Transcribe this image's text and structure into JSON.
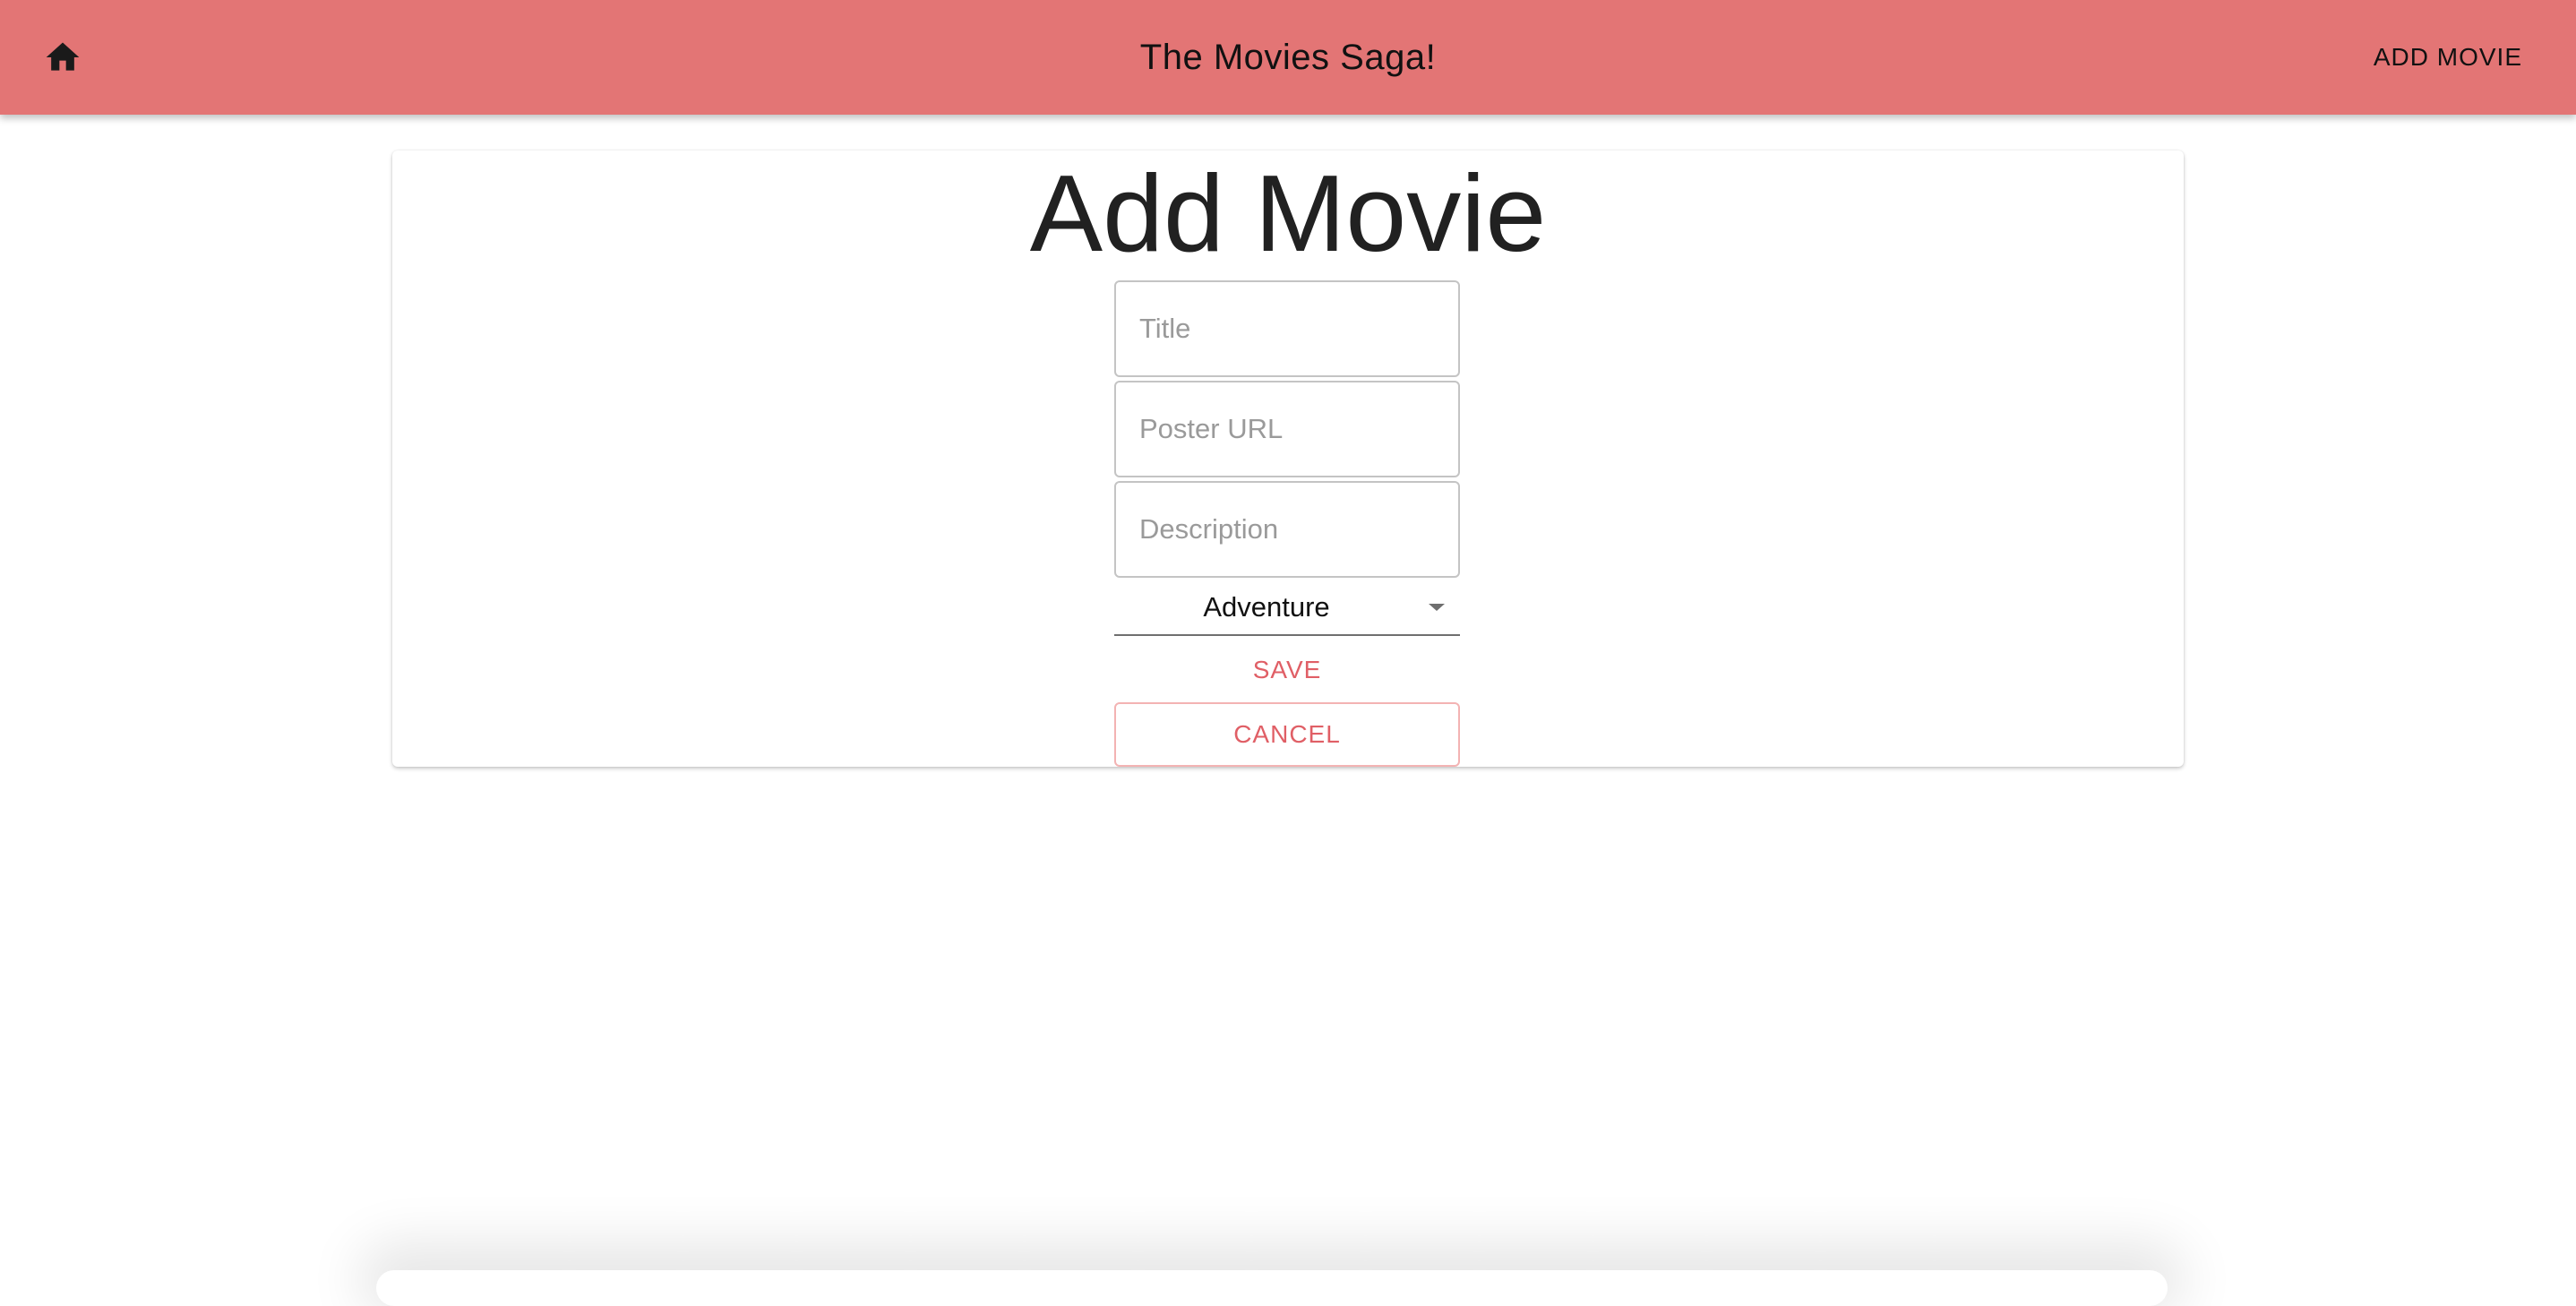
{
  "header": {
    "home_icon": "home-icon",
    "title": "The Movies Saga!",
    "add_movie_label": "ADD MOVIE",
    "background_color": "#e37575"
  },
  "form": {
    "heading": "Add Movie",
    "fields": {
      "title": {
        "value": "",
        "placeholder": "Title"
      },
      "poster_url": {
        "value": "",
        "placeholder": "Poster URL"
      },
      "description": {
        "value": "",
        "placeholder": "Description"
      }
    },
    "genre": {
      "selected": "Adventure",
      "arrow_icon": "caret-down-icon"
    },
    "save_label": "SAVE",
    "cancel_label": "CANCEL",
    "accent_color": "#e05f66"
  }
}
